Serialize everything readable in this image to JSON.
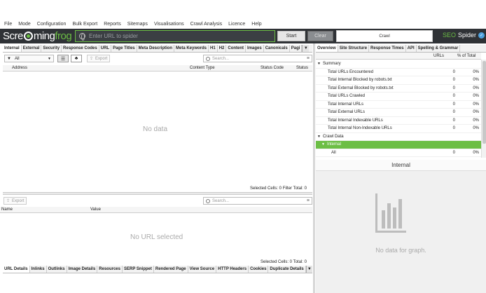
{
  "menu": [
    "File",
    "Mode",
    "Configuration",
    "Bulk Export",
    "Reports",
    "Sitemaps",
    "Visualisations",
    "Crawl Analysis",
    "Licence",
    "Help"
  ],
  "header": {
    "logo_text_1": "Scre",
    "logo_text_2": "ming",
    "logo_text_3": "frog",
    "url_placeholder": "Enter URL to spider",
    "start_label": "Start",
    "clear_label": "Clear",
    "mode_label": "Crawl",
    "brand_seo": "SEO",
    "brand_spider": "Spider"
  },
  "left_tabs": [
    "Internal",
    "External",
    "Security",
    "Response Codes",
    "URL",
    "Page Titles",
    "Meta Description",
    "Meta Keywords",
    "H1",
    "H2",
    "Content",
    "Images",
    "Canonicals",
    "Pagi"
  ],
  "right_tabs": [
    "Overview",
    "Site Structure",
    "Response Times",
    "API",
    "Spelling & Grammar"
  ],
  "top_toolbar": {
    "filter": "All",
    "export_label": "Export",
    "search_placeholder": "Search..."
  },
  "main_table": {
    "columns": [
      "Address",
      "Content Type",
      "Status Code",
      "Status"
    ],
    "empty_text": "No data",
    "status": "Selected Cells:  0  Filter Total:  0"
  },
  "detail_toolbar": {
    "export_label": "Export",
    "search_placeholder": "Search..."
  },
  "detail_table": {
    "columns": [
      "Name",
      "Value"
    ],
    "empty_text": "No URL selected",
    "status": "Selected Cells:  0  Total:  0"
  },
  "bottom_tabs": [
    "URL Details",
    "Inlinks",
    "Outlinks",
    "Image Details",
    "Resources",
    "SERP Snippet",
    "Rendered Page",
    "View Source",
    "HTTP Headers",
    "Cookies",
    "Duplicate Details"
  ],
  "overview": {
    "col_urls": "URLs",
    "col_pct": "% of Total",
    "summary_label": "Summary",
    "rows": [
      {
        "label": "Total URLs Encountered",
        "urls": "0",
        "pct": "0%"
      },
      {
        "label": "Total Internal Blocked by robots.txt",
        "urls": "0",
        "pct": "0%"
      },
      {
        "label": "Total External Blocked by robots.txt",
        "urls": "0",
        "pct": "0%"
      },
      {
        "label": "Total URLs Crawled",
        "urls": "0",
        "pct": "0%"
      },
      {
        "label": "Total Internal URLs",
        "urls": "0",
        "pct": "0%"
      },
      {
        "label": "Total External URLs",
        "urls": "0",
        "pct": "0%"
      },
      {
        "label": "Total Internal Indexable URLs",
        "urls": "0",
        "pct": "0%"
      },
      {
        "label": "Total Internal Non-Indexable URLs",
        "urls": "0",
        "pct": "0%"
      }
    ],
    "crawl_data_label": "Crawl Data",
    "internal_label": "Internal",
    "all_row": {
      "label": "All",
      "urls": "0",
      "pct": "0%"
    }
  },
  "graph": {
    "title": "Internal",
    "empty_text": "No data for graph."
  },
  "colors": {
    "accent": "#6cbe45",
    "header_bg": "#2f3236"
  }
}
